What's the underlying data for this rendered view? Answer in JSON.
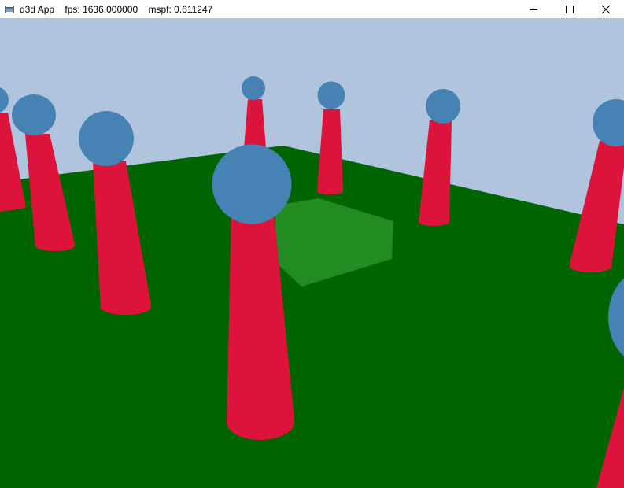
{
  "window": {
    "app_name": "d3d App",
    "fps_label": "fps: 1636.000000",
    "mspf_label": "mspf: 0.611247",
    "controls": {
      "minimize_icon": "minimize-icon",
      "maximize_icon": "maximize-icon",
      "close_icon": "close-icon"
    }
  },
  "scene": {
    "colors": {
      "sky": "#b0c4de",
      "ground": "#006400",
      "box": "#228b22",
      "cylinder": "#dc143c",
      "sphere": "#4682b4"
    }
  }
}
